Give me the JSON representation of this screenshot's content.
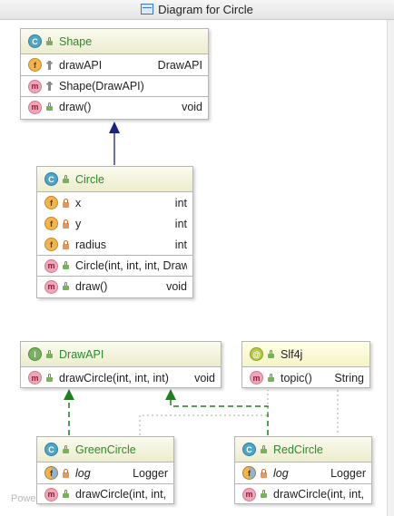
{
  "window": {
    "title": "Diagram for Circle"
  },
  "watermark": "Powe",
  "nodes": {
    "shape": {
      "name": "Shape",
      "fields": [
        {
          "name": "drawAPI",
          "type": "DrawAPI"
        }
      ],
      "constructors": [
        {
          "name": "Shape(DrawAPI)"
        }
      ],
      "methods": [
        {
          "name": "draw()",
          "type": "void"
        }
      ]
    },
    "circle": {
      "name": "Circle",
      "fields": [
        {
          "name": "x",
          "type": "int"
        },
        {
          "name": "y",
          "type": "int"
        },
        {
          "name": "radius",
          "type": "int"
        }
      ],
      "constructors": [
        {
          "name": "Circle(int, int, int, DrawA"
        }
      ],
      "methods": [
        {
          "name": "draw()",
          "type": "void"
        }
      ]
    },
    "drawapi": {
      "name": "DrawAPI",
      "methods": [
        {
          "name": "drawCircle(int, int, int)",
          "type": "void"
        }
      ]
    },
    "slf4j": {
      "name": "Slf4j",
      "methods": [
        {
          "name": "topic()",
          "type": "String"
        }
      ]
    },
    "greencircle": {
      "name": "GreenCircle",
      "fields": [
        {
          "name": "log",
          "type": "Logger"
        }
      ],
      "methods": [
        {
          "name": "drawCircle(int, int, in"
        }
      ]
    },
    "redcircle": {
      "name": "RedCircle",
      "fields": [
        {
          "name": "log",
          "type": "Logger"
        }
      ],
      "methods": [
        {
          "name": "drawCircle(int, int, in"
        }
      ]
    }
  },
  "badges": {
    "class": "C",
    "interface": "I",
    "annotation": "@",
    "field": "f",
    "method": "m"
  },
  "colors": {
    "extends_arrow": "#1a237e",
    "implements_arrow": "#1e7f1e",
    "annotation_link": "#9e9e9e",
    "class_name": "#2b8a2b"
  }
}
